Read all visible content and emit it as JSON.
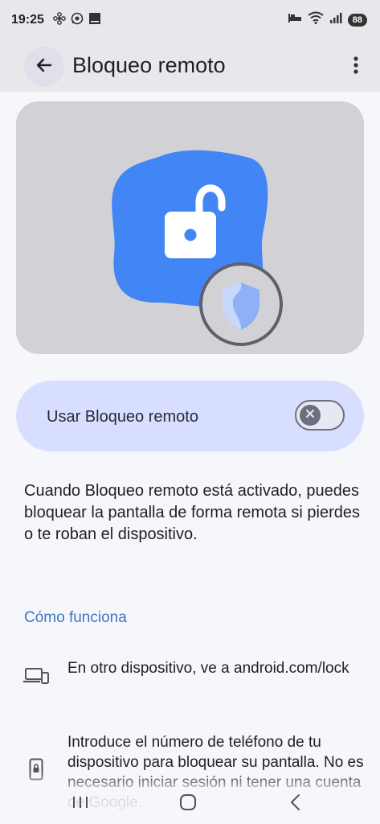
{
  "status_bar": {
    "time": "19:25",
    "battery": "88"
  },
  "app_bar": {
    "title": "Bloqueo remoto"
  },
  "toggle": {
    "label": "Usar Bloqueo remoto",
    "state": "off"
  },
  "description": "Cuando Bloqueo remoto está activado, puedes bloquear la pantalla de forma remota si pierdes o te roban el dispositivo.",
  "how_it_works": {
    "link": "Cómo funciona"
  },
  "steps": [
    {
      "icon": "devices-icon",
      "text": "En otro dispositivo, ve a android.com/lock"
    },
    {
      "icon": "lock-phone-icon",
      "text": "Introduce el número de teléfono de tu dispositivo para bloquear su pantalla. No es necesario iniciar sesión ni tener una cuenta de Google."
    }
  ],
  "colors": {
    "accent": "#3c75c9",
    "card": "#d8deff",
    "hero_bg": "#d2d2d6",
    "blob": "#4285f4"
  }
}
